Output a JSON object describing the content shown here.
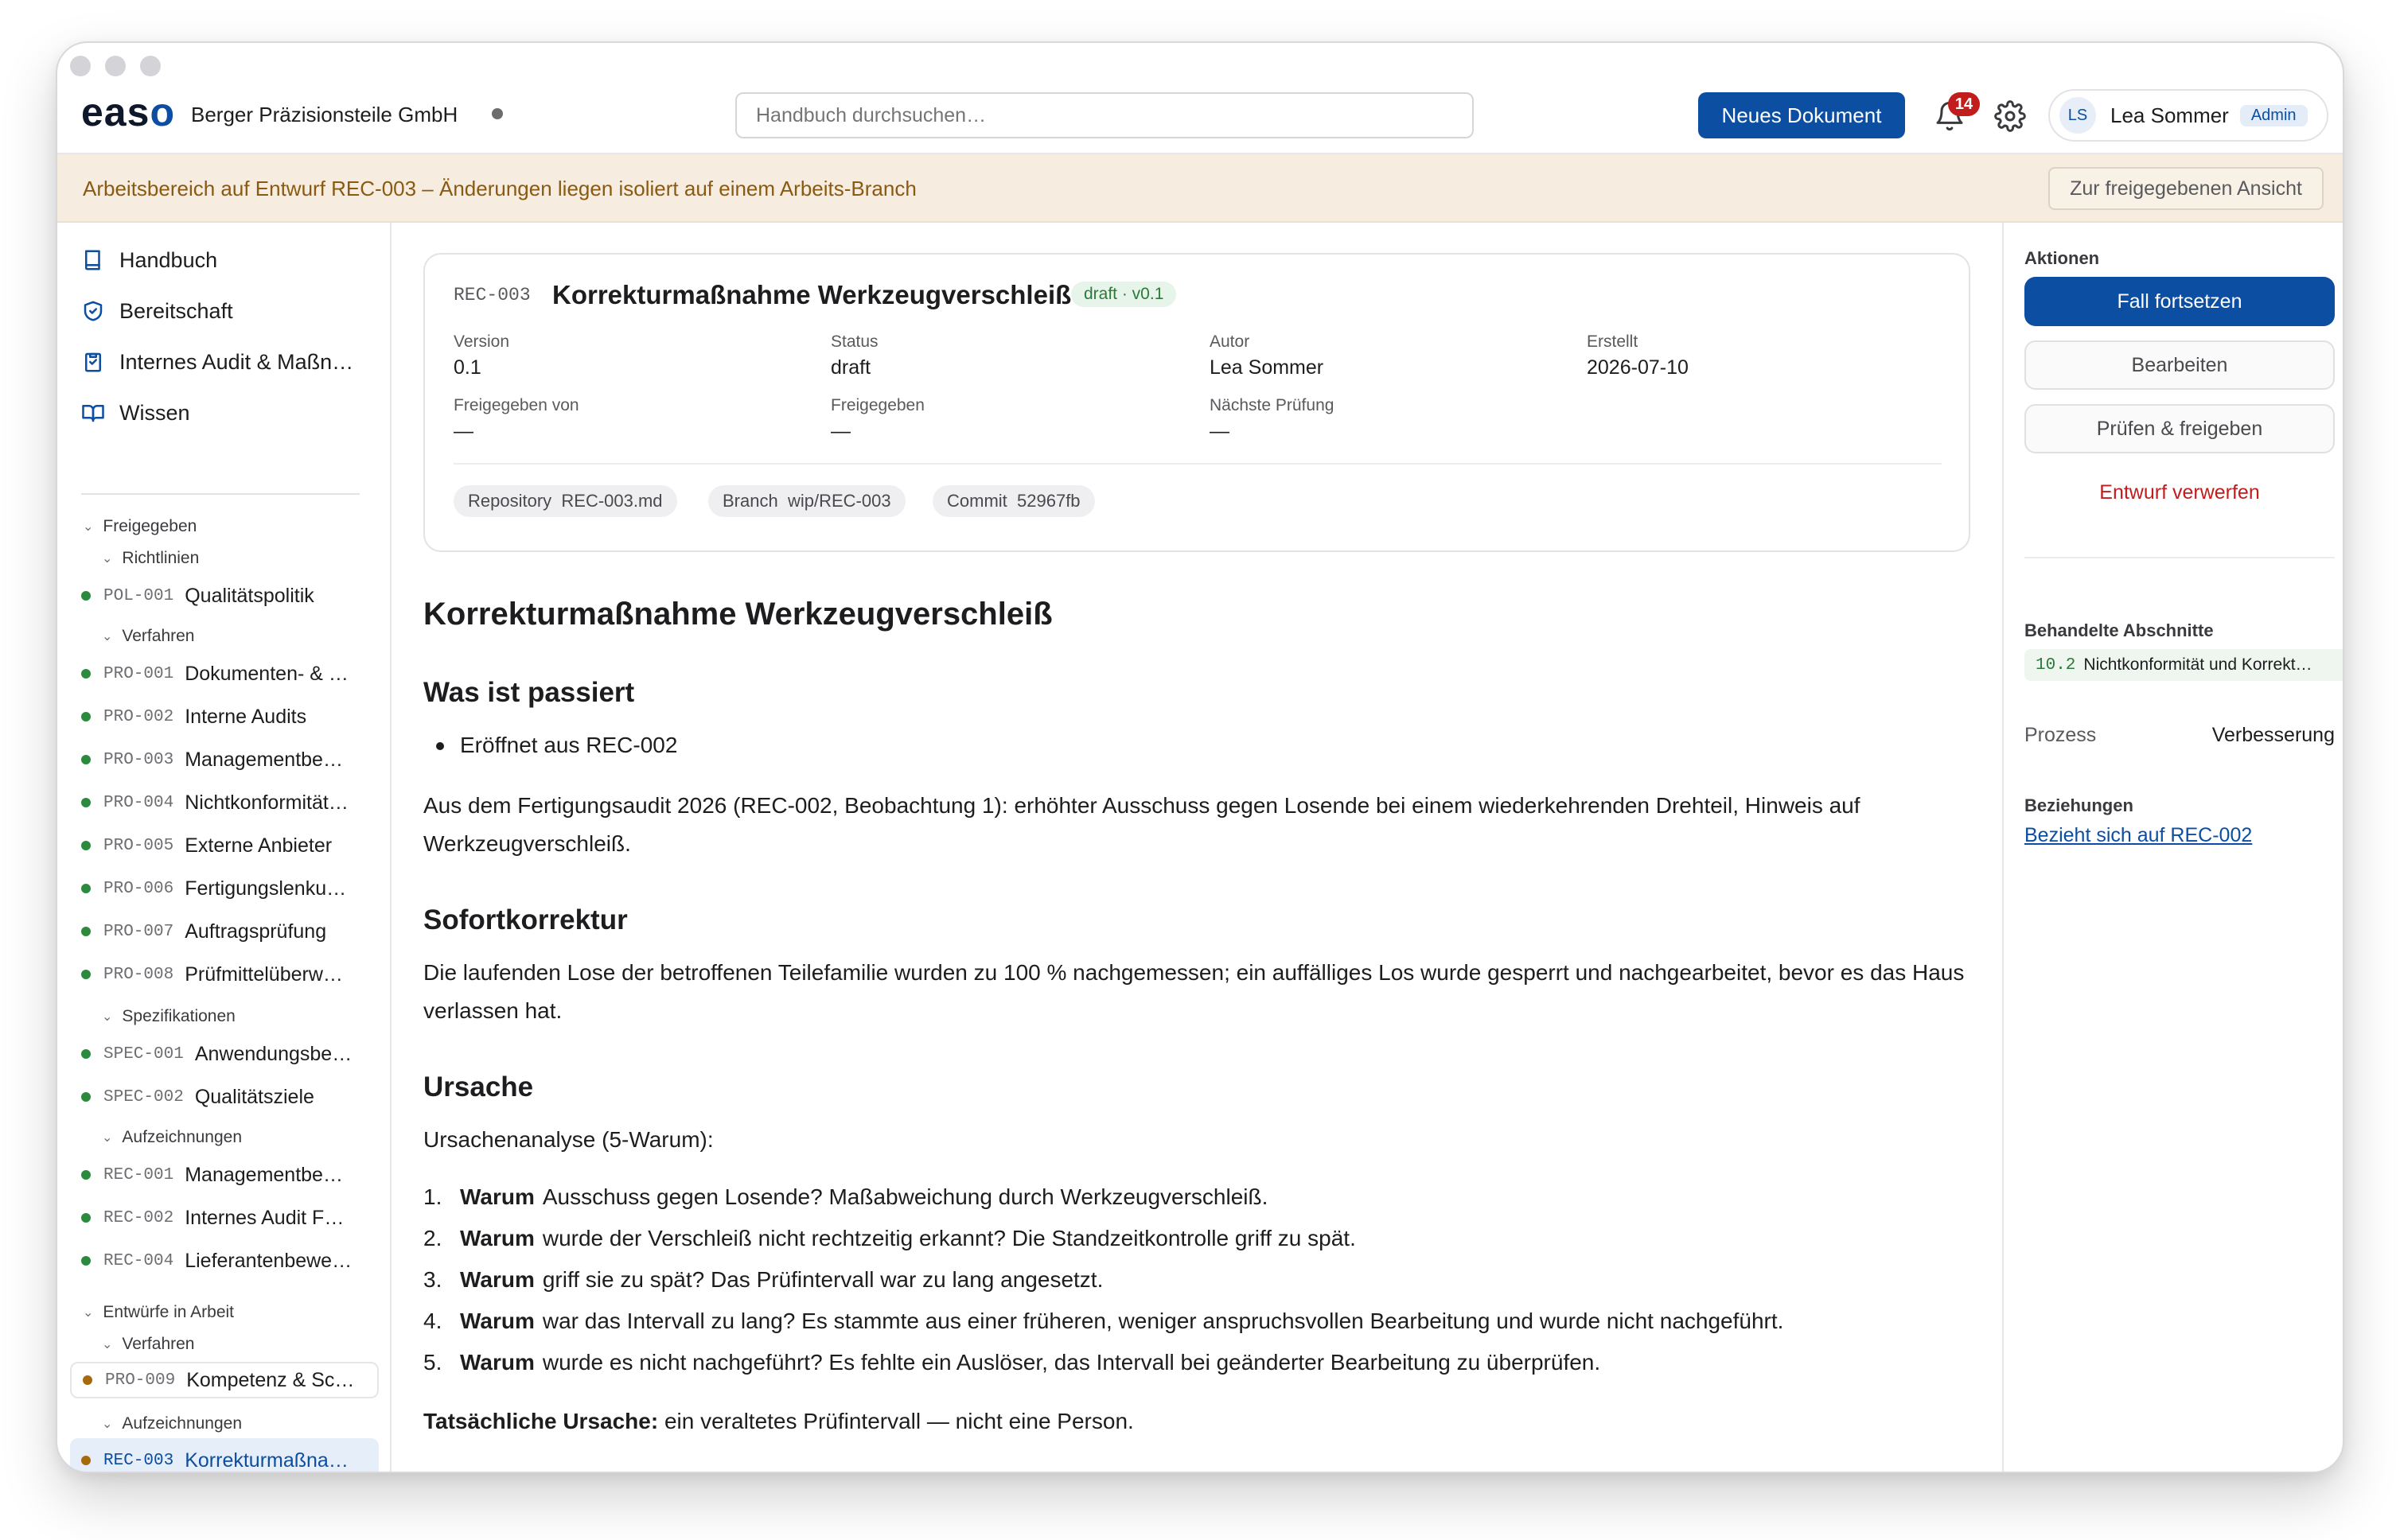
{
  "app": {
    "brand": "easo",
    "organization": "Berger Präzisionsteile GmbH",
    "search_placeholder": "Handbuch durchsuchen…",
    "new_document": "Neues Dokument",
    "notifications": "14",
    "user": {
      "initials": "LS",
      "name": "Lea Sommer",
      "role": "Admin"
    }
  },
  "banner": {
    "text": "Arbeitsbereich auf Entwurf REC-003 – Änderungen liegen isoliert auf einem Arbeits-Branch",
    "button": "Zur freigegebenen Ansicht"
  },
  "sidebar": {
    "nav": [
      {
        "label": "Handbuch",
        "icon": "book-icon"
      },
      {
        "label": "Bereitschaft",
        "icon": "shield-check-icon"
      },
      {
        "label": "Internes Audit & Maßn…",
        "icon": "clipboard-icon"
      },
      {
        "label": "Wissen",
        "icon": "open-book-icon"
      }
    ],
    "released_label": "Freigegeben",
    "drafts_label": "Entwürfe in Arbeit",
    "groups": {
      "policies": "Richtlinien",
      "procedures": "Verfahren",
      "specs": "Spezifikationen",
      "records": "Aufzeichnungen",
      "draft_procedures": "Verfahren",
      "draft_records": "Aufzeichnungen"
    },
    "docs": [
      {
        "code": "POL-001",
        "title": "Qualitätspolitik"
      },
      {
        "code": "PRO-001",
        "title": "Dokumenten- & …"
      },
      {
        "code": "PRO-002",
        "title": "Interne Audits"
      },
      {
        "code": "PRO-003",
        "title": "Managementbe…"
      },
      {
        "code": "PRO-004",
        "title": "Nichtkonformität…"
      },
      {
        "code": "PRO-005",
        "title": "Externe Anbieter"
      },
      {
        "code": "PRO-006",
        "title": "Fertigungslenku…"
      },
      {
        "code": "PRO-007",
        "title": "Auftragsprüfung"
      },
      {
        "code": "PRO-008",
        "title": "Prüfmittelüberw…"
      },
      {
        "code": "SPEC-001",
        "title": "Anwendungsbe…"
      },
      {
        "code": "SPEC-002",
        "title": "Qualitätsziele"
      },
      {
        "code": "REC-001",
        "title": "Managementbe…"
      },
      {
        "code": "REC-002",
        "title": "Internes Audit F…"
      },
      {
        "code": "REC-004",
        "title": "Lieferantenbewe…"
      },
      {
        "code": "PRO-009",
        "title": "Kompetenz & Sc…"
      },
      {
        "code": "REC-003",
        "title": "Korrekturmaßna…"
      }
    ]
  },
  "document": {
    "code": "REC-003",
    "title": "Korrekturmaßnahme Werkzeugverschleiß",
    "badge": "draft · v0.1",
    "fields": [
      {
        "label": "Version",
        "value": "0.1"
      },
      {
        "label": "Status",
        "value": "draft"
      },
      {
        "label": "Autor",
        "value": "Lea Sommer"
      },
      {
        "label": "Erstellt",
        "value": "2026-07-10"
      },
      {
        "label": "Freigegeben von",
        "value": "—"
      },
      {
        "label": "Freigegeben",
        "value": "—"
      },
      {
        "label": "Nächste Prüfung",
        "value": "—"
      }
    ],
    "chips": [
      {
        "label": "Repository",
        "value": "REC-003.md"
      },
      {
        "label": "Branch",
        "value": "wip/REC-003"
      },
      {
        "label": "Commit",
        "value": "52967fb"
      }
    ]
  },
  "body": {
    "h1": "Korrekturmaßnahme Werkzeugverschleiß",
    "s1_title": "Was ist passiert",
    "s1_bullet": "Eröffnet aus REC-002",
    "s1_text": "Aus dem Fertigungsaudit 2026 (REC-002, Beobachtung 1): erhöhter Ausschuss gegen Losende bei einem wiederkehrenden Drehteil, Hinweis auf Werkzeugverschleiß.",
    "s2_title": "Sofortkorrektur",
    "s2_text": "Die laufenden Lose der betroffenen Teilefamilie wurden zu 100 % nachgemessen; ein auffälliges Los wurde gesperrt und nachgearbeitet, bevor es das Haus verlassen hat.",
    "s3_title": "Ursache",
    "s3_intro": "Ursachenanalyse (5-Warum):",
    "why_word": "Warum",
    "whys": [
      "Ausschuss gegen Losende? Maßabweichung durch Werkzeugverschleiß.",
      "wurde der Verschleiß nicht rechtzeitig erkannt? Die Standzeitkontrolle griff zu spät.",
      "griff sie zu spät? Das Prüfintervall war zu lang angesetzt.",
      "war das Intervall zu lang? Es stammte aus einer früheren, weniger anspruchsvollen Bearbeitung und wurde nicht nachgeführt.",
      "wurde es nicht nachgeführt? Es fehlte ein Auslöser, das Intervall bei geänderter Bearbeitung zu überprüfen."
    ],
    "root_label": "Tatsächliche Ursache:",
    "root_text": "ein veraltetes Prüfintervall — nicht eine Person."
  },
  "panel": {
    "actions_label": "Aktionen",
    "continue": "Fall fortsetzen",
    "edit": "Bearbeiten",
    "review": "Prüfen & freigeben",
    "discard": "Entwurf verwerfen",
    "sections_label": "Behandelte Abschnitte",
    "section_code": "10.2",
    "section_title": "Nichtkonformität und Korrekt…",
    "process_label": "Prozess",
    "process_value": "Verbesserung",
    "relations_label": "Beziehungen",
    "relation_link": "Bezieht sich auf REC-002"
  }
}
